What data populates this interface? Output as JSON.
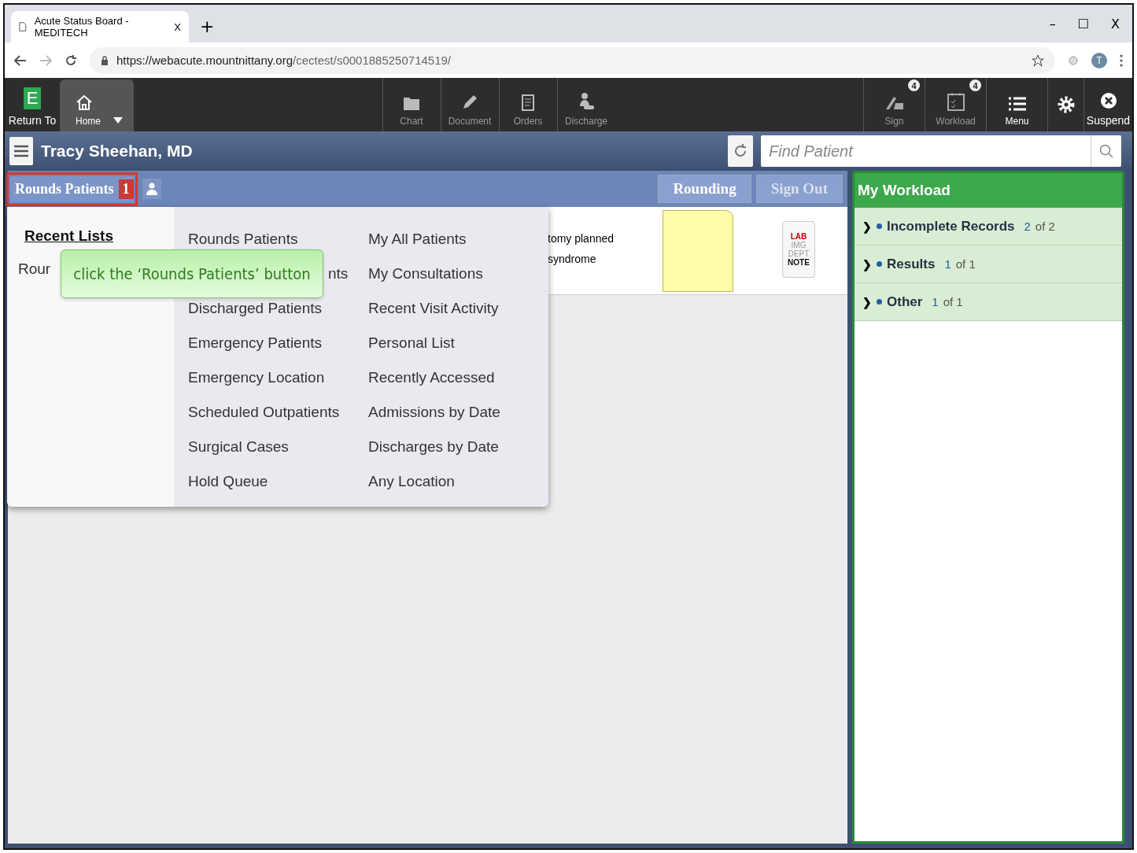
{
  "browser": {
    "tab_title": "Acute Status Board - MEDITECH",
    "tab_close": "X",
    "new_tab": "+",
    "url_host": "https://webacute.mountnittany.org",
    "url_path": "/cectest/s0001885250714519/",
    "profile_initial": "T",
    "window_controls": [
      "–",
      "☐",
      "X"
    ]
  },
  "toolbar": {
    "left": [
      {
        "label": "Return To",
        "kind": "logo"
      },
      {
        "label": "Home",
        "kind": "home"
      }
    ],
    "middle": [
      {
        "label": "Chart",
        "kind": "folder",
        "disabled": true
      },
      {
        "label": "Document",
        "kind": "pencil",
        "disabled": true
      },
      {
        "label": "Orders",
        "kind": "clipboard",
        "disabled": true
      },
      {
        "label": "Discharge",
        "kind": "person",
        "disabled": true
      }
    ],
    "right": [
      {
        "label": "Sign",
        "kind": "sign",
        "badge": "4",
        "disabled": true
      },
      {
        "label": "Workload",
        "kind": "calendar",
        "badge": "4",
        "disabled": true
      },
      {
        "label": "Menu",
        "kind": "menu",
        "disabled": false
      },
      {
        "kind": "gear"
      },
      {
        "label": "Suspend",
        "kind": "suspend",
        "disabled": false
      }
    ],
    "logo_letter": "E"
  },
  "header": {
    "user": "Tracy Sheehan, MD",
    "search_placeholder": "Find Patient"
  },
  "list_bar": {
    "title": "Rounds Patients",
    "count": "1",
    "buttons": [
      {
        "label": "Rounding",
        "disabled": false
      },
      {
        "label": "Sign Out",
        "disabled": true
      }
    ]
  },
  "patient_row": {
    "lines": [
      "tomy planned",
      "syndrome"
    ],
    "result_tags": [
      {
        "label": "LAB",
        "on": true
      },
      {
        "label": "IMG",
        "on": false
      },
      {
        "label": "DEPT",
        "on": false
      },
      {
        "label": "NOTE",
        "on": true
      }
    ]
  },
  "dropdown": {
    "recent_title": "Recent Lists",
    "recent_items": [
      "Rour"
    ],
    "columns": [
      [
        {
          "label": "Rounds Patients",
          "kind": "full"
        },
        {
          "label": "nts",
          "kind": "clipped"
        },
        {
          "label": "Discharged Patients",
          "kind": "full"
        },
        {
          "label": "Emergency Patients",
          "kind": "full"
        },
        {
          "label": "Emergency Location",
          "kind": "full"
        },
        {
          "label": "Scheduled Outpatients",
          "kind": "full"
        },
        {
          "label": "Surgical Cases",
          "kind": "full"
        },
        {
          "label": "Hold Queue",
          "kind": "full"
        }
      ],
      [
        {
          "label": "My All Patients",
          "kind": "full"
        },
        {
          "label": "My Consultations",
          "kind": "full"
        },
        {
          "label": "Recent Visit Activity",
          "kind": "full"
        },
        {
          "label": "Personal List",
          "kind": "full"
        },
        {
          "label": "Recently Accessed",
          "kind": "full"
        },
        {
          "label": "Admissions by Date",
          "kind": "full"
        },
        {
          "label": "Discharges by Date",
          "kind": "full"
        },
        {
          "label": "Any Location",
          "kind": "full"
        }
      ]
    ]
  },
  "tooltip": "click the ‘Rounds Patients’ button",
  "workload": {
    "title": "My Workload",
    "expand_glyph": "❯",
    "items": [
      {
        "label": "Incomplete Records",
        "count": "2",
        "of": "of 2"
      },
      {
        "label": "Results",
        "count": "1",
        "of": "of 1"
      },
      {
        "label": "Other",
        "count": "1",
        "of": "of 1"
      }
    ]
  }
}
